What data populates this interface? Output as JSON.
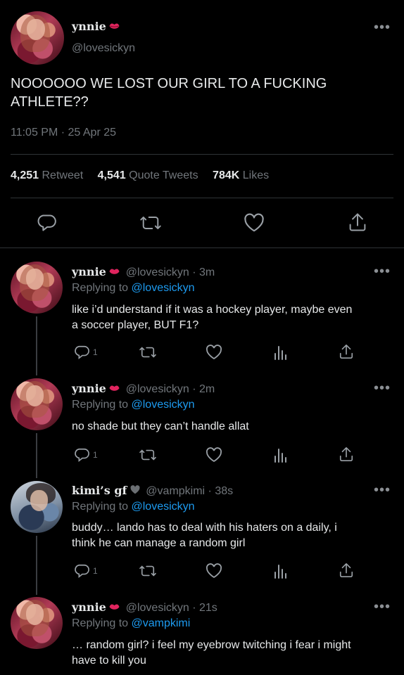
{
  "main_tweet": {
    "display_name": "ynnie",
    "handle": "@lovesickyn",
    "text_line1": "NOOOOOO WE LOST OUR GIRL TO A FUCKING",
    "text_line2": "ATHLETE??",
    "timestamp": "11:05 PM · 25 Apr 25",
    "retweets": "4,251",
    "retweets_label": "Retweet",
    "quotes": "4,541",
    "quotes_label": "Quote Tweets",
    "likes": "784K",
    "likes_label": "Likes"
  },
  "replies": [
    {
      "display_name": "ynnie",
      "handle_time": "@lovesickyn · 3m",
      "replying_label": "Replying to",
      "replying_to": "@lovesickyn",
      "text_line1": "like i’d understand if it was a hockey player, maybe even",
      "text_line2": "a soccer player, BUT F1?",
      "reply_count": "1"
    },
    {
      "display_name": "ynnie",
      "handle_time": "@lovesickyn · 2m",
      "replying_label": "Replying to",
      "replying_to": "@lovesickyn",
      "text_line1": "no shade but they can’t handle allat",
      "text_line2": "",
      "reply_count": "1"
    },
    {
      "display_name": "kimi’s gf",
      "handle_time": "@vampkimi · 38s",
      "replying_label": "Replying to",
      "replying_to": "@lovesickyn",
      "text_line1": "buddy… lando has to deal with his haters on a daily, i",
      "text_line2": "think he can manage a random girl",
      "reply_count": "1"
    },
    {
      "display_name": "ynnie",
      "handle_time": "@lovesickyn · 21s",
      "replying_label": "Replying to",
      "replying_to": "@vampkimi",
      "text_line1": "… random girl? i feel my eyebrow twitching i fear i might",
      "text_line2": "have to kill you"
    }
  ],
  "icons": {
    "more": "more-icon",
    "reply": "reply-icon",
    "retweet": "retweet-icon",
    "like": "heart-icon",
    "share": "share-icon",
    "analytics": "analytics-icon",
    "badge": "lips-icon",
    "heart_badge": "black-heart-icon"
  },
  "colors": {
    "background": "#000000",
    "text": "#e7e9ea",
    "muted": "#71767b",
    "link": "#1d9bf0",
    "badge": "#e0245e"
  }
}
